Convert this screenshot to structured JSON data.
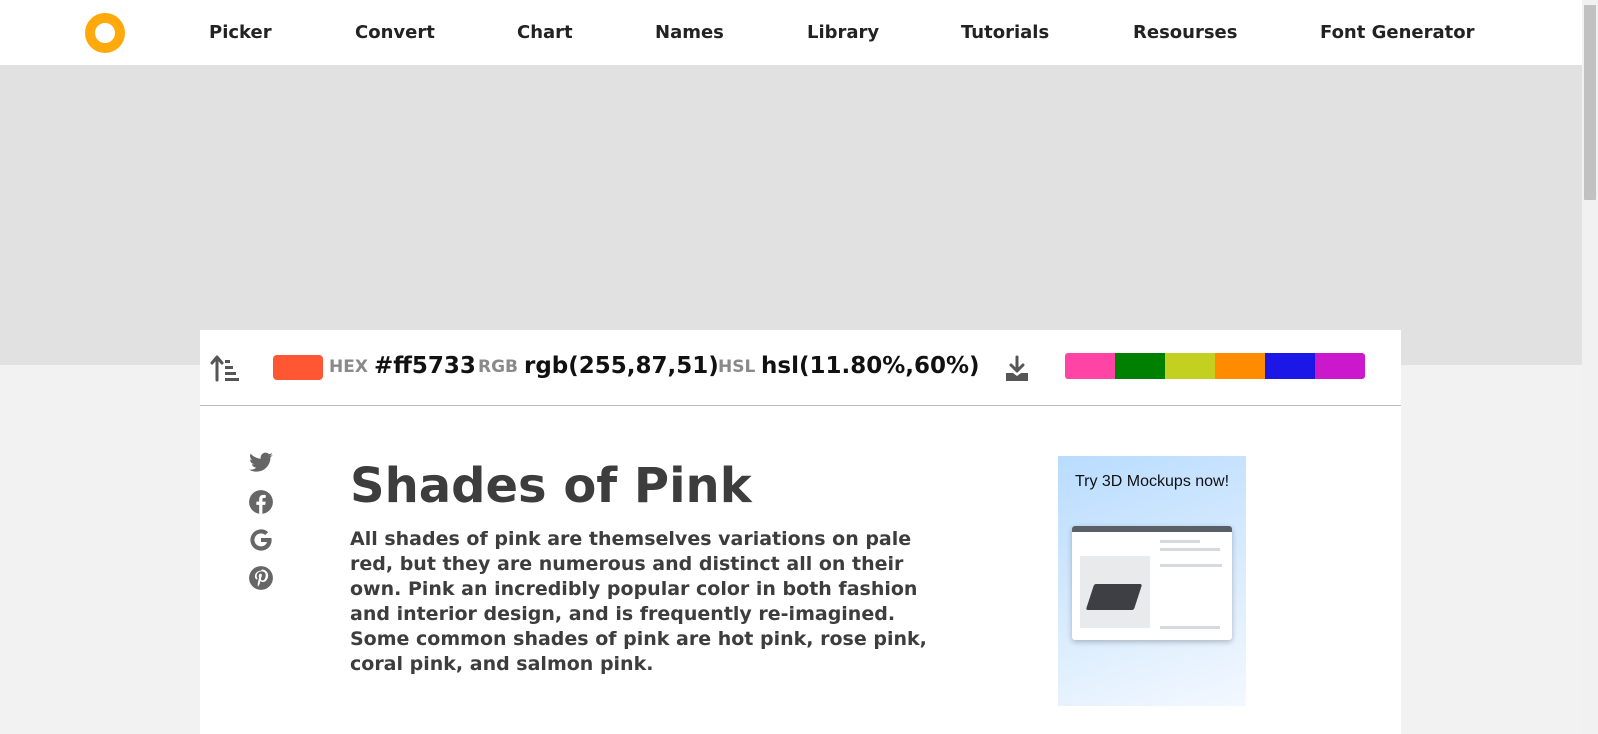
{
  "nav": {
    "items": [
      {
        "label": "Picker"
      },
      {
        "label": "Convert"
      },
      {
        "label": "Chart"
      },
      {
        "label": "Names"
      },
      {
        "label": "Library"
      },
      {
        "label": "Tutorials"
      },
      {
        "label": "Resourses"
      },
      {
        "label": "Font Generator"
      }
    ],
    "logo_color": "#ffa90c"
  },
  "colorbar": {
    "swatch_color": "#ff5733",
    "hex_label": "HEX",
    "hex_value": "#ff5733",
    "rgb_label": "RGB",
    "rgb_value": "rgb(255,87,51)",
    "hsl_label": "HSL",
    "hsl_value": "hsl(11.80%,60%)",
    "palette": [
      "#ff44a6",
      "#008000",
      "#c4d01f",
      "#ff8c00",
      "#1b17e6",
      "#cc18cc"
    ]
  },
  "share": {
    "icons": [
      "twitter-icon",
      "facebook-icon",
      "google-icon",
      "pinterest-icon"
    ]
  },
  "content": {
    "title": "Shades of Pink",
    "description": "All shades of pink are themselves variations on pale red, but they are numerous and distinct all on their own. Pink an incredibly popular color in both fashion and interior design, and is frequently re-imagined. Some common shades of pink are hot pink, rose pink, coral pink, and salmon pink."
  },
  "side_ad": {
    "text": "Try 3D Mockups now!"
  }
}
